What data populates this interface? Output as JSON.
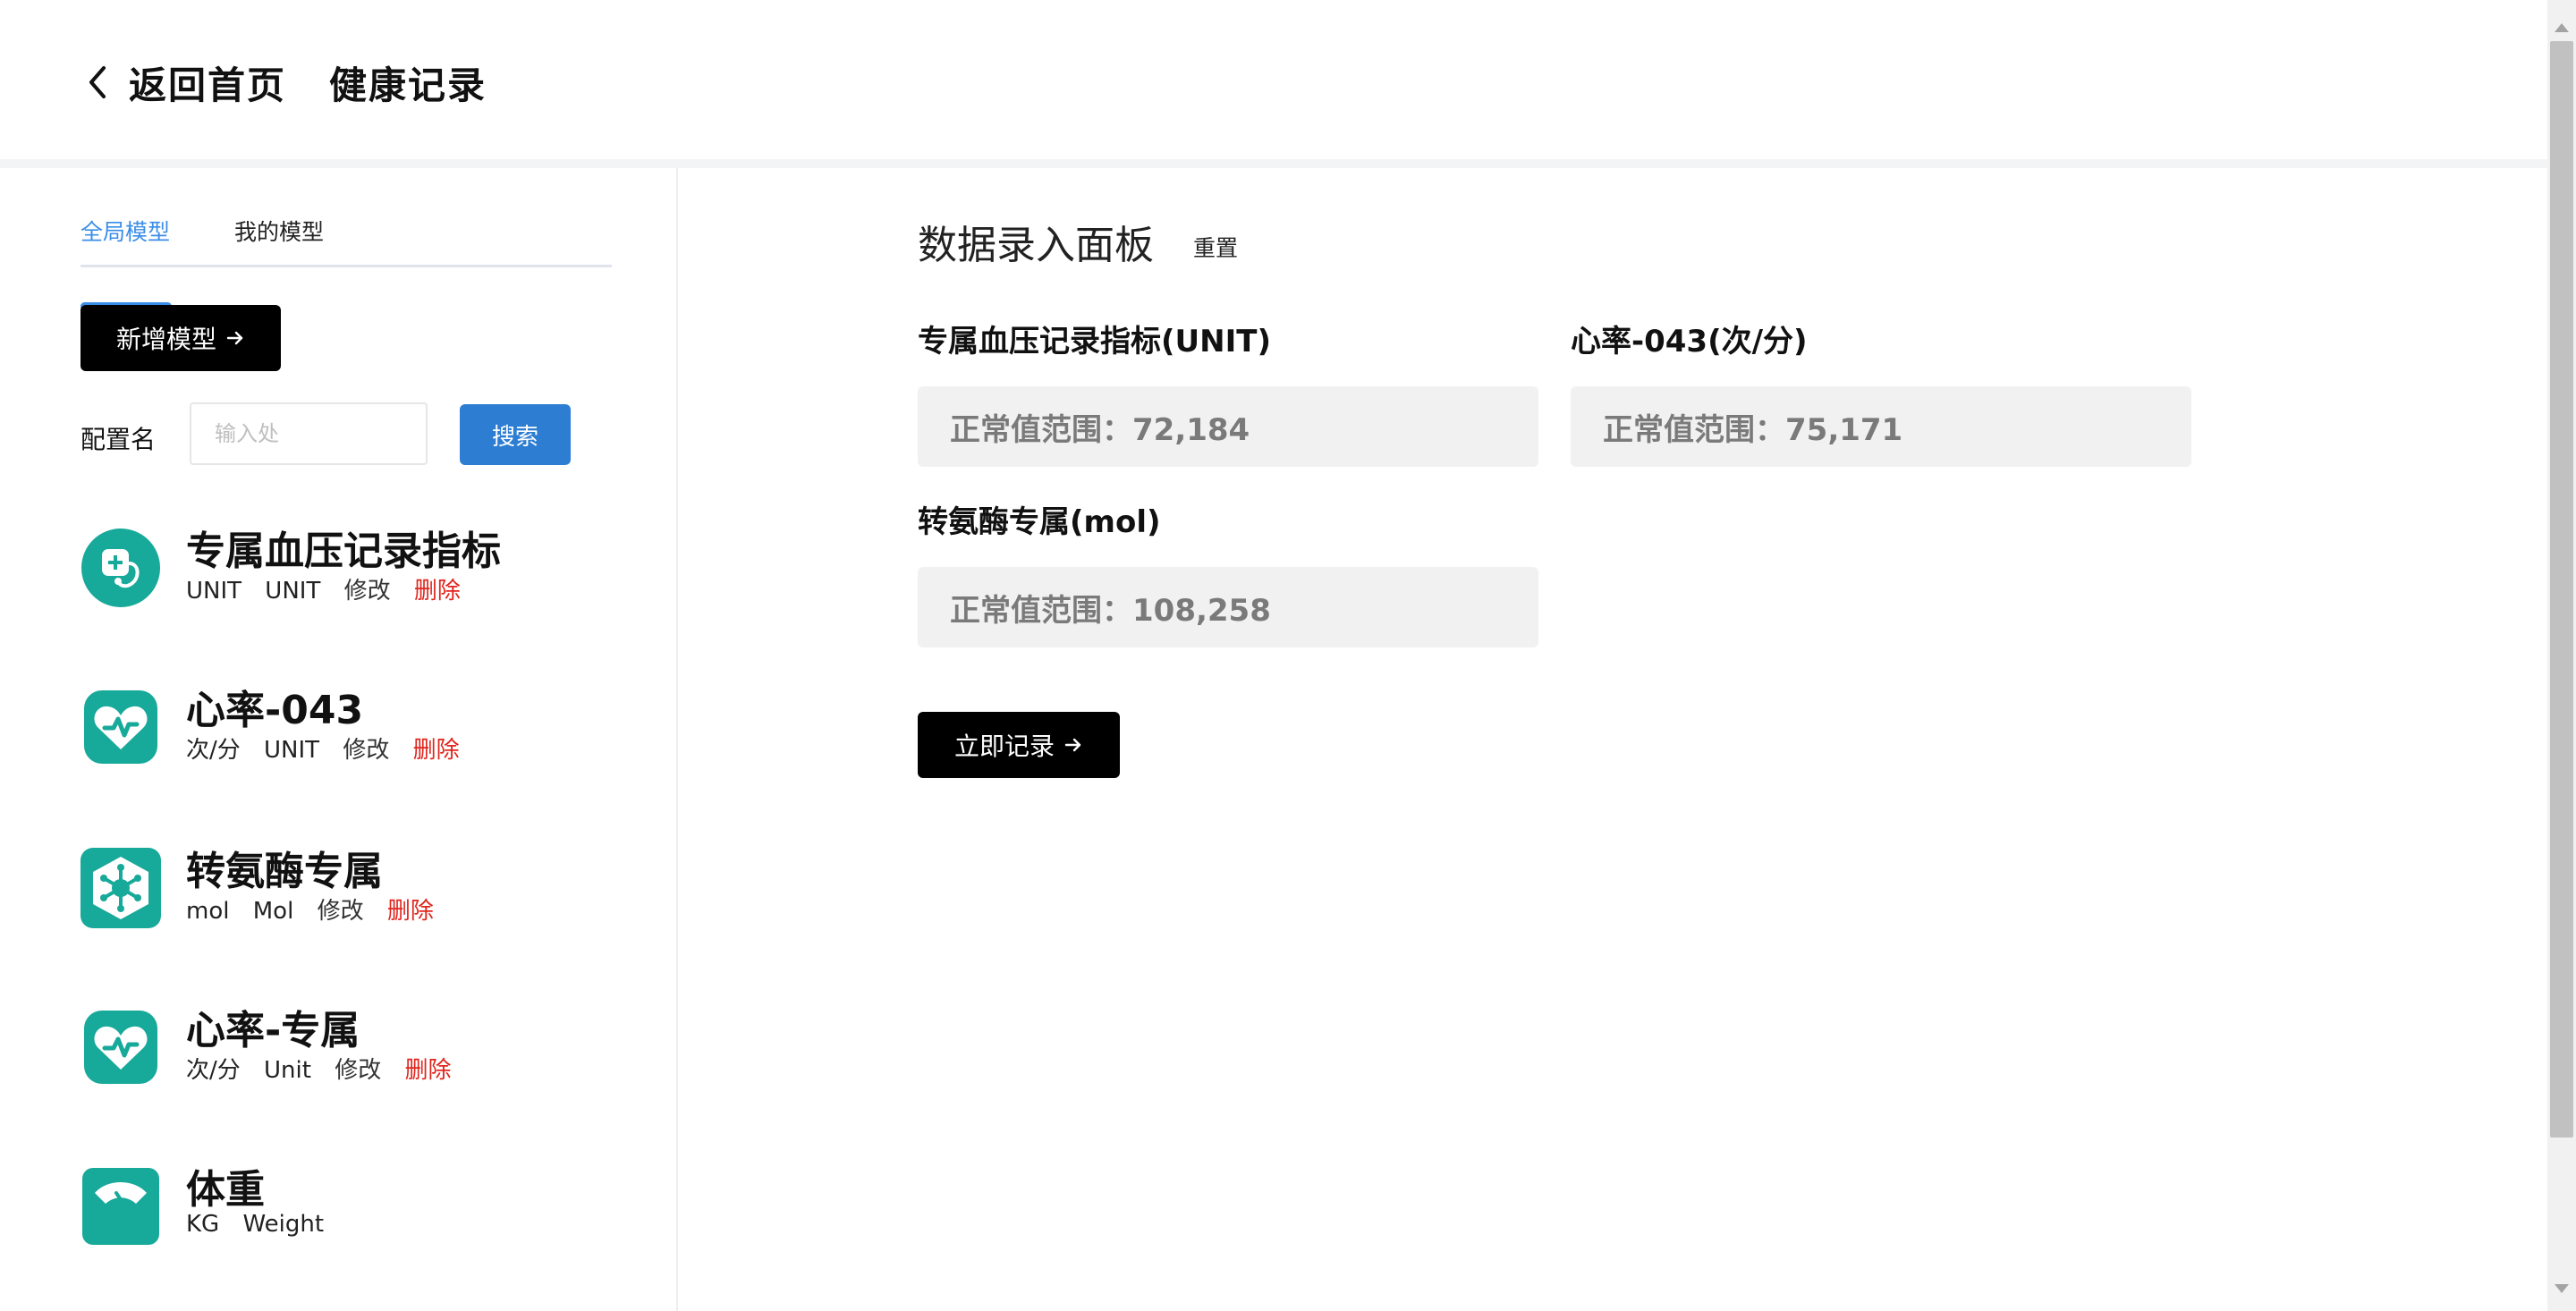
{
  "header": {
    "back_label": "返回首页",
    "title": "健康记录"
  },
  "sidebar": {
    "tabs": [
      {
        "label": "全局模型",
        "active": true
      },
      {
        "label": "我的模型",
        "active": false
      }
    ],
    "add_button": "新增模型",
    "config_label": "配置名",
    "search_input": {
      "value": "",
      "placeholder": "输入处"
    },
    "search_button": "搜索",
    "models": [
      {
        "title": "专属血压记录指标",
        "unit": "UNIT",
        "unit2": "UNIT",
        "edit": "修改",
        "delete": "删除",
        "icon": "blood-pressure-icon"
      },
      {
        "title": "心率-043",
        "unit": "次/分",
        "unit2": "UNIT",
        "edit": "修改",
        "delete": "删除",
        "icon": "heart-rate-icon"
      },
      {
        "title": "转氨酶专属",
        "unit": "mol",
        "unit2": "Mol",
        "edit": "修改",
        "delete": "删除",
        "icon": "molecule-icon"
      },
      {
        "title": "心率-专属",
        "unit": "次/分",
        "unit2": "Unit",
        "edit": "修改",
        "delete": "删除",
        "icon": "heart-rate-icon"
      },
      {
        "title": "体重",
        "unit": "KG",
        "unit2": "Weight",
        "icon": "scale-icon"
      }
    ]
  },
  "panel": {
    "title": "数据录入面板",
    "reset": "重置",
    "fields": [
      {
        "label": "专属血压记录指标(UNIT)",
        "placeholder": "正常值范围：72,184"
      },
      {
        "label": "心率-043(次/分)",
        "placeholder": "正常值范围：75,171"
      },
      {
        "label": "转氨酶专属(mol)",
        "placeholder": "正常值范围：108,258"
      }
    ],
    "submit": "立即记录"
  },
  "colors": {
    "accent": "#3b8ee8",
    "search_button": "#2d7dd2",
    "icon_teal": "#17a99a",
    "danger": "#e0251d",
    "dark_button": "#000000"
  }
}
